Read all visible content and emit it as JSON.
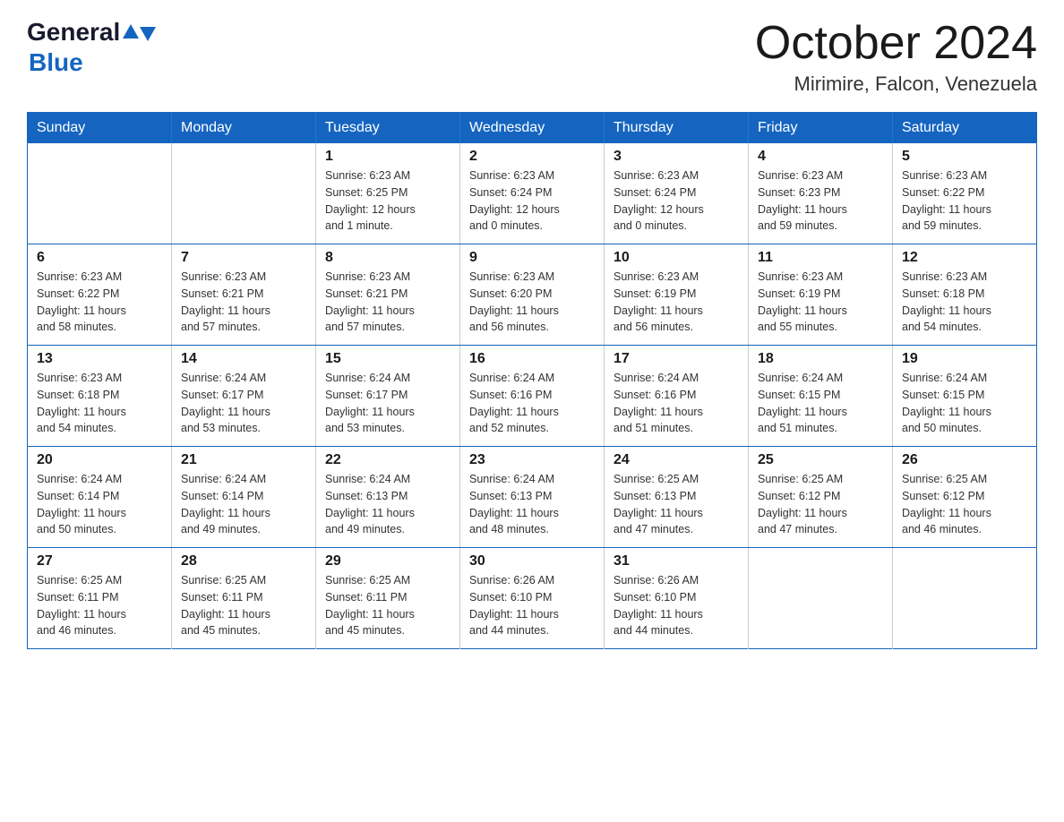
{
  "header": {
    "logo_general": "General",
    "logo_blue": "Blue",
    "month_title": "October 2024",
    "location": "Mirimire, Falcon, Venezuela"
  },
  "days_of_week": [
    "Sunday",
    "Monday",
    "Tuesday",
    "Wednesday",
    "Thursday",
    "Friday",
    "Saturday"
  ],
  "weeks": [
    {
      "days": [
        {
          "number": "",
          "info": ""
        },
        {
          "number": "",
          "info": ""
        },
        {
          "number": "1",
          "info": "Sunrise: 6:23 AM\nSunset: 6:25 PM\nDaylight: 12 hours\nand 1 minute."
        },
        {
          "number": "2",
          "info": "Sunrise: 6:23 AM\nSunset: 6:24 PM\nDaylight: 12 hours\nand 0 minutes."
        },
        {
          "number": "3",
          "info": "Sunrise: 6:23 AM\nSunset: 6:24 PM\nDaylight: 12 hours\nand 0 minutes."
        },
        {
          "number": "4",
          "info": "Sunrise: 6:23 AM\nSunset: 6:23 PM\nDaylight: 11 hours\nand 59 minutes."
        },
        {
          "number": "5",
          "info": "Sunrise: 6:23 AM\nSunset: 6:22 PM\nDaylight: 11 hours\nand 59 minutes."
        }
      ]
    },
    {
      "days": [
        {
          "number": "6",
          "info": "Sunrise: 6:23 AM\nSunset: 6:22 PM\nDaylight: 11 hours\nand 58 minutes."
        },
        {
          "number": "7",
          "info": "Sunrise: 6:23 AM\nSunset: 6:21 PM\nDaylight: 11 hours\nand 57 minutes."
        },
        {
          "number": "8",
          "info": "Sunrise: 6:23 AM\nSunset: 6:21 PM\nDaylight: 11 hours\nand 57 minutes."
        },
        {
          "number": "9",
          "info": "Sunrise: 6:23 AM\nSunset: 6:20 PM\nDaylight: 11 hours\nand 56 minutes."
        },
        {
          "number": "10",
          "info": "Sunrise: 6:23 AM\nSunset: 6:19 PM\nDaylight: 11 hours\nand 56 minutes."
        },
        {
          "number": "11",
          "info": "Sunrise: 6:23 AM\nSunset: 6:19 PM\nDaylight: 11 hours\nand 55 minutes."
        },
        {
          "number": "12",
          "info": "Sunrise: 6:23 AM\nSunset: 6:18 PM\nDaylight: 11 hours\nand 54 minutes."
        }
      ]
    },
    {
      "days": [
        {
          "number": "13",
          "info": "Sunrise: 6:23 AM\nSunset: 6:18 PM\nDaylight: 11 hours\nand 54 minutes."
        },
        {
          "number": "14",
          "info": "Sunrise: 6:24 AM\nSunset: 6:17 PM\nDaylight: 11 hours\nand 53 minutes."
        },
        {
          "number": "15",
          "info": "Sunrise: 6:24 AM\nSunset: 6:17 PM\nDaylight: 11 hours\nand 53 minutes."
        },
        {
          "number": "16",
          "info": "Sunrise: 6:24 AM\nSunset: 6:16 PM\nDaylight: 11 hours\nand 52 minutes."
        },
        {
          "number": "17",
          "info": "Sunrise: 6:24 AM\nSunset: 6:16 PM\nDaylight: 11 hours\nand 51 minutes."
        },
        {
          "number": "18",
          "info": "Sunrise: 6:24 AM\nSunset: 6:15 PM\nDaylight: 11 hours\nand 51 minutes."
        },
        {
          "number": "19",
          "info": "Sunrise: 6:24 AM\nSunset: 6:15 PM\nDaylight: 11 hours\nand 50 minutes."
        }
      ]
    },
    {
      "days": [
        {
          "number": "20",
          "info": "Sunrise: 6:24 AM\nSunset: 6:14 PM\nDaylight: 11 hours\nand 50 minutes."
        },
        {
          "number": "21",
          "info": "Sunrise: 6:24 AM\nSunset: 6:14 PM\nDaylight: 11 hours\nand 49 minutes."
        },
        {
          "number": "22",
          "info": "Sunrise: 6:24 AM\nSunset: 6:13 PM\nDaylight: 11 hours\nand 49 minutes."
        },
        {
          "number": "23",
          "info": "Sunrise: 6:24 AM\nSunset: 6:13 PM\nDaylight: 11 hours\nand 48 minutes."
        },
        {
          "number": "24",
          "info": "Sunrise: 6:25 AM\nSunset: 6:13 PM\nDaylight: 11 hours\nand 47 minutes."
        },
        {
          "number": "25",
          "info": "Sunrise: 6:25 AM\nSunset: 6:12 PM\nDaylight: 11 hours\nand 47 minutes."
        },
        {
          "number": "26",
          "info": "Sunrise: 6:25 AM\nSunset: 6:12 PM\nDaylight: 11 hours\nand 46 minutes."
        }
      ]
    },
    {
      "days": [
        {
          "number": "27",
          "info": "Sunrise: 6:25 AM\nSunset: 6:11 PM\nDaylight: 11 hours\nand 46 minutes."
        },
        {
          "number": "28",
          "info": "Sunrise: 6:25 AM\nSunset: 6:11 PM\nDaylight: 11 hours\nand 45 minutes."
        },
        {
          "number": "29",
          "info": "Sunrise: 6:25 AM\nSunset: 6:11 PM\nDaylight: 11 hours\nand 45 minutes."
        },
        {
          "number": "30",
          "info": "Sunrise: 6:26 AM\nSunset: 6:10 PM\nDaylight: 11 hours\nand 44 minutes."
        },
        {
          "number": "31",
          "info": "Sunrise: 6:26 AM\nSunset: 6:10 PM\nDaylight: 11 hours\nand 44 minutes."
        },
        {
          "number": "",
          "info": ""
        },
        {
          "number": "",
          "info": ""
        }
      ]
    }
  ]
}
